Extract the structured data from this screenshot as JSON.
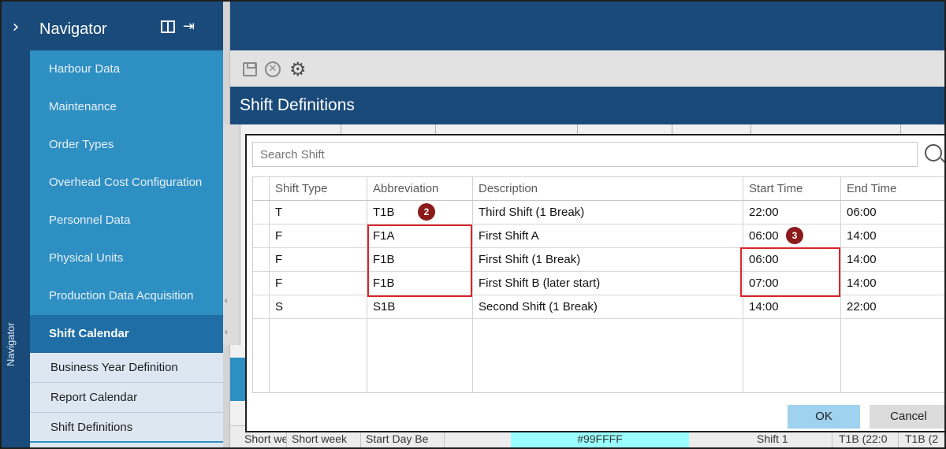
{
  "rail": {
    "expand_icon": "chevron-right-icon",
    "vertical_label": "Navigator"
  },
  "navigator": {
    "title": "Navigator",
    "items": [
      {
        "label": "Harbour Data"
      },
      {
        "label": "Maintenance"
      },
      {
        "label": "Order Types"
      },
      {
        "label": "Overhead Cost Configuration"
      },
      {
        "label": "Personnel Data"
      },
      {
        "label": "Physical Units"
      },
      {
        "label": "Production Data Acquisition"
      },
      {
        "label": "Shift Calendar"
      }
    ],
    "subitems": [
      {
        "label": "Business Year Definition"
      },
      {
        "label": "Report Calendar"
      },
      {
        "label": "Shift Definitions"
      }
    ]
  },
  "toolbar": {
    "icons": [
      "save-icon",
      "cancel-circle-icon",
      "gear-icon"
    ]
  },
  "page": {
    "title": "Shift Definitions"
  },
  "background_row": {
    "cells": [
      "Short we",
      "Short week",
      "Start Day Be",
      "#99FFFF",
      "Shift 1",
      "T1B (22:0",
      "T1B (2"
    ],
    "color": "#99FFFF"
  },
  "dialog": {
    "search_placeholder": "Search Shift",
    "columns": [
      "Shift Type",
      "Abbreviation",
      "Description",
      "Start Time",
      "End Time"
    ],
    "rows": [
      {
        "type": "T",
        "abbr": "T1B",
        "desc": "Third Shift (1 Break)",
        "start": "22:00",
        "end": "06:00"
      },
      {
        "type": "F",
        "abbr": "F1A",
        "desc": "First Shift A",
        "start": "06:00",
        "end": "14:00"
      },
      {
        "type": "F",
        "abbr": "F1B",
        "desc": "First Shift (1 Break)",
        "start": "06:00",
        "end": "14:00"
      },
      {
        "type": "F",
        "abbr": "F1B",
        "desc": "First Shift B (later start)",
        "start": "07:00",
        "end": "14:00"
      },
      {
        "type": "S",
        "abbr": "S1B",
        "desc": "Second Shift (1 Break)",
        "start": "14:00",
        "end": "22:00"
      }
    ],
    "ok_label": "OK",
    "cancel_label": "Cancel",
    "badges": [
      "2",
      "3"
    ],
    "highlight_color": "#D9262C"
  }
}
